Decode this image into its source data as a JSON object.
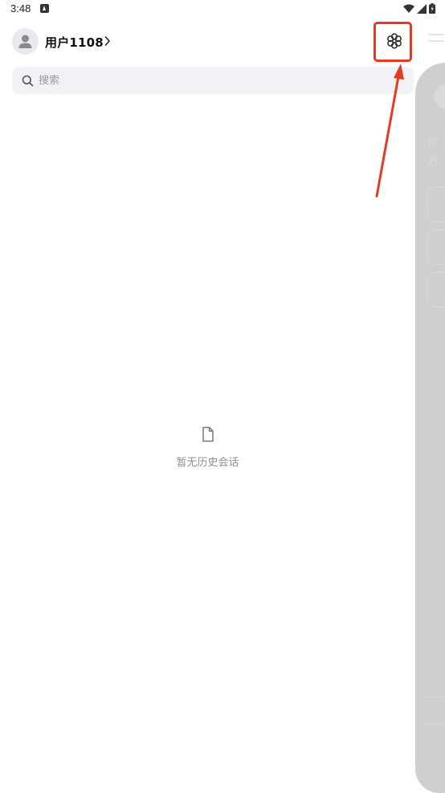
{
  "status_bar": {
    "time": "3:48"
  },
  "header": {
    "username": "用户1108",
    "avatar_icon": "user-icon",
    "chevron_icon": "chevron-right-icon",
    "settings_icon": "flower-settings-icon"
  },
  "search": {
    "placeholder": "搜索",
    "value": ""
  },
  "empty_state": {
    "icon": "document-icon",
    "text": "暂无历史会话"
  },
  "colors": {
    "accent_annotation": "#e23b26",
    "search_bg": "#f1f2f5",
    "muted_text": "#8e8e93",
    "overlay": "#cfcfcf"
  }
}
